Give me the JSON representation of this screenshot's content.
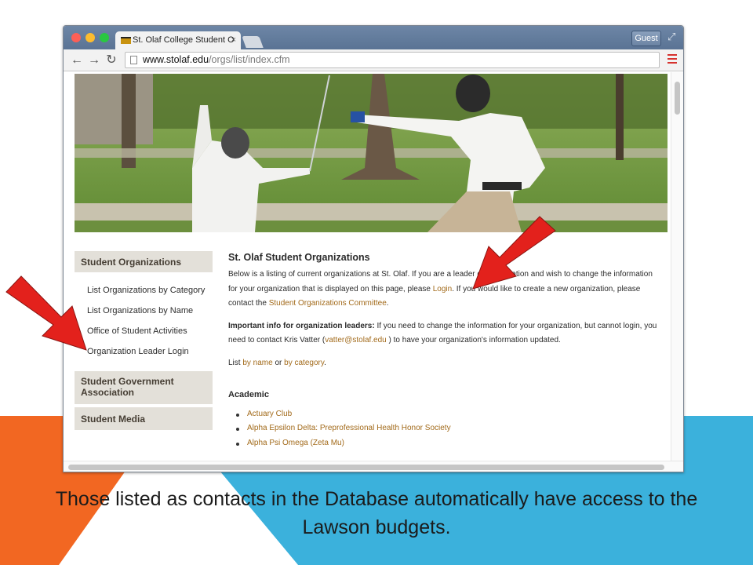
{
  "colors": {
    "accent_orange": "#f26722",
    "accent_blue": "#3bb1dc",
    "link": "#a26a1a",
    "sidebar_header_bg": "#e3e0d9",
    "arrow_red": "#e3211c"
  },
  "browser": {
    "tab_title": "St. Olaf College Student O",
    "tab_close_icon": "×",
    "profile_button": "Guest",
    "url_host": "www.stolaf.edu",
    "url_path": "/orgs/list/index.cfm",
    "back_icon": "←",
    "forward_icon": "→",
    "reload_icon": "↻"
  },
  "sidebar": {
    "sections": [
      {
        "label": "Student Organizations"
      },
      {
        "label": "Student Government Association"
      },
      {
        "label": "Student Media"
      }
    ],
    "links": [
      {
        "label": "List Organizations by Category"
      },
      {
        "label": "List Organizations by Name"
      },
      {
        "label": "Office of Student Activities"
      },
      {
        "label": "Organization Leader Login"
      }
    ]
  },
  "main": {
    "title": "St. Olaf Student Organizations",
    "intro_1": "Below is a listing of current organizations at St. Olaf. If you are a leader of",
    "intro_2": "organization and wish to change the information for your organization that is displayed on this page, please",
    "intro_login": "Login",
    "intro_3": ". If you would like to create a new organization, please contact the",
    "intro_committee": "Student Organizations Committee",
    "intro_4": ".",
    "info_bold": "Important info for organization leaders:",
    "info_1": " If you need to change the information for your organization, but cannot login, you need to contact Kris Vatter (",
    "info_email": "vatter@stolaf.edu",
    "info_2": " ) to have your organization's information updated.",
    "list_prefix": "List ",
    "list_by_name": "by name",
    "list_or": " or ",
    "list_by_category": "by category",
    "list_suffix": ".",
    "section_heading": "Academic",
    "orgs": [
      {
        "name": "Actuary Club"
      },
      {
        "name": "Alpha Epsilon Delta: Preprofessional Health Honor Society"
      },
      {
        "name": "Alpha Psi Omega (Zeta Mu)"
      }
    ]
  },
  "caption": "Those listed as contacts in the Database automatically have access to the Lawson budgets."
}
